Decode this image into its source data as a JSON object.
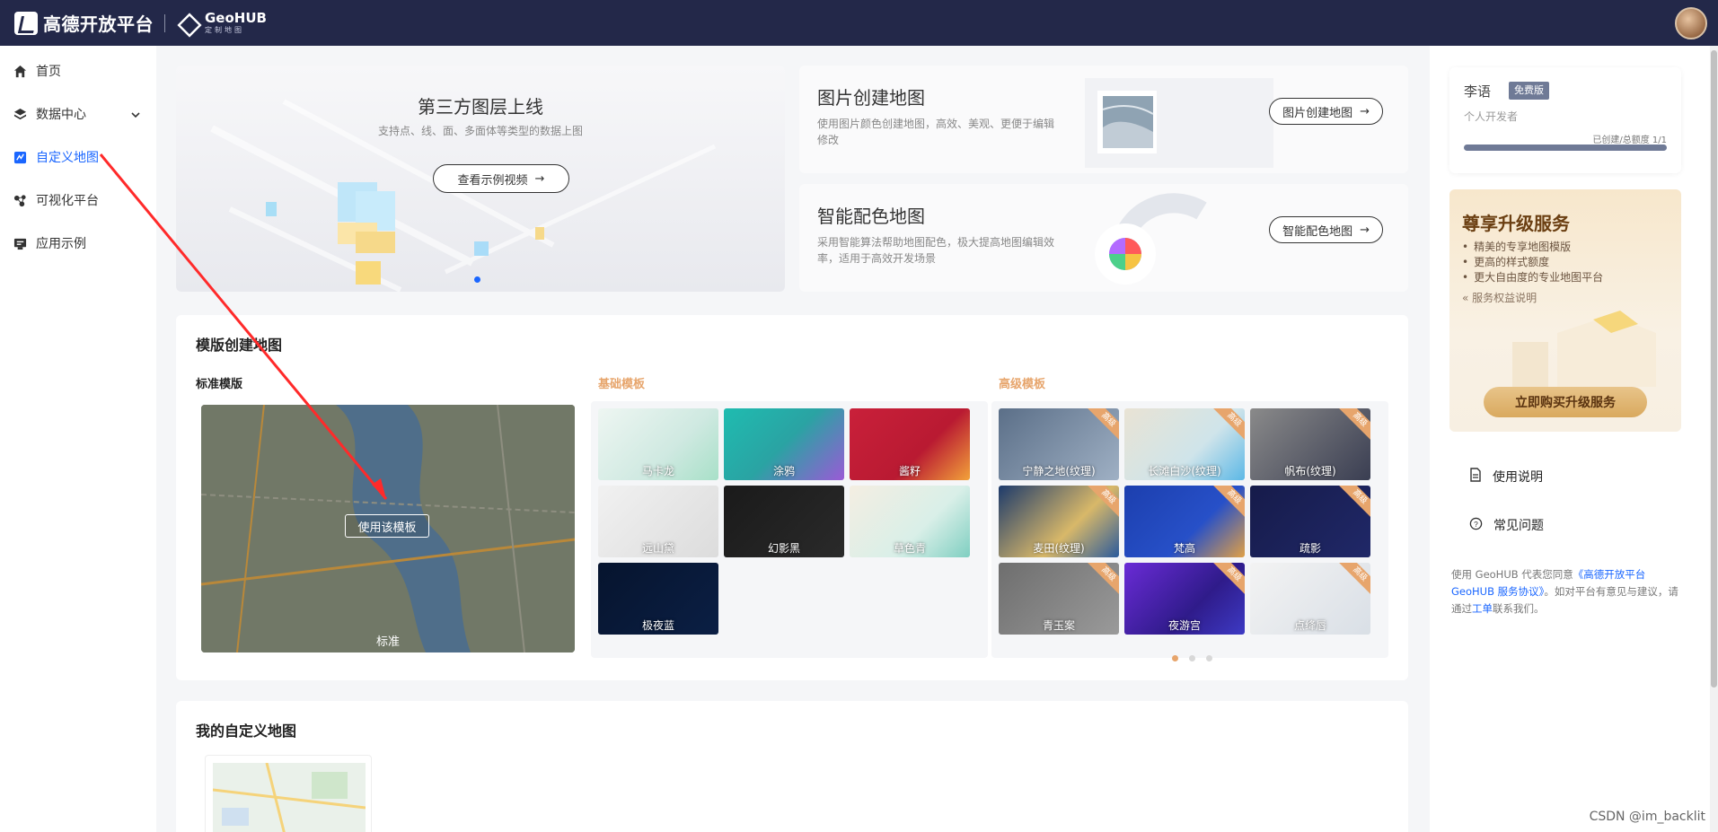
{
  "topbar": {
    "brand": "高德开放平台",
    "geohub_name": "GeoHUB",
    "geohub_sub": "定制地图"
  },
  "sidebar": {
    "items": [
      {
        "label": "首页",
        "icon": "home-icon"
      },
      {
        "label": "数据中心",
        "icon": "layers-icon"
      },
      {
        "label": "自定义地图",
        "icon": "custom-map-icon"
      },
      {
        "label": "可视化平台",
        "icon": "visualization-icon"
      },
      {
        "label": "应用示例",
        "icon": "app-example-icon"
      }
    ]
  },
  "banner": {
    "title": "第三方图层上线",
    "subtitle": "支持点、线、面、多面体等类型的数据上图",
    "button": "查看示例视频"
  },
  "features": [
    {
      "title": "图片创建地图",
      "desc": "使用图片颜色创建地图，高效、美观、更便于编辑修改",
      "button": "图片创建地图"
    },
    {
      "title": "智能配色地图",
      "desc": "采用智能算法帮助地图配色，极大提高地图编辑效率，适用于高效开发场景",
      "button": "智能配色地图"
    }
  ],
  "templates": {
    "title": "模版创建地图",
    "standard_label": "标准模版",
    "basic_label": "基础模板",
    "advanced_label": "高级模板",
    "standard": {
      "name": "标准",
      "use_button": "使用该模板"
    },
    "basic": [
      "马卡龙",
      "涂鸦",
      "酱籽",
      "远山黛",
      "幻影黑",
      "草色青",
      "极夜蓝"
    ],
    "advanced": [
      "宁静之地(纹理)",
      "长滩白沙(纹理)",
      "帆布(纹理)",
      "麦田(纹理)",
      "梵高",
      "疏影",
      "青玉案",
      "夜游宫",
      "点绛唇"
    ],
    "ribbon": "高级"
  },
  "my_maps": {
    "title": "我的自定义地图"
  },
  "user": {
    "name": "李语",
    "badge": "免费版",
    "role": "个人开发者",
    "quota": "已创建/总额度 1/1",
    "usage": 1.0
  },
  "upgrade": {
    "title": "尊享升级服务",
    "items": [
      "精美的专享地图模版",
      "更高的样式额度",
      "更大自由度的专业地图平台"
    ],
    "link": "服务权益说明",
    "button": "立即购买升级服务"
  },
  "help": {
    "manual": "使用说明",
    "faq": "常见问题"
  },
  "notice": {
    "pre": "使用 GeoHUB 代表您同意",
    "link": "《高德开放平台 GeoHUB 服务协议》",
    "mid": "。如对平台有意见与建议，请通过",
    "link2": "工单",
    "post": "联系我们。"
  },
  "watermark": "CSDN @im_backlit",
  "colors": {
    "topbar": "#232849",
    "accent": "#1a66ff",
    "premium": "#e7a56c",
    "annotation_arrow": "#ff2a2a"
  }
}
